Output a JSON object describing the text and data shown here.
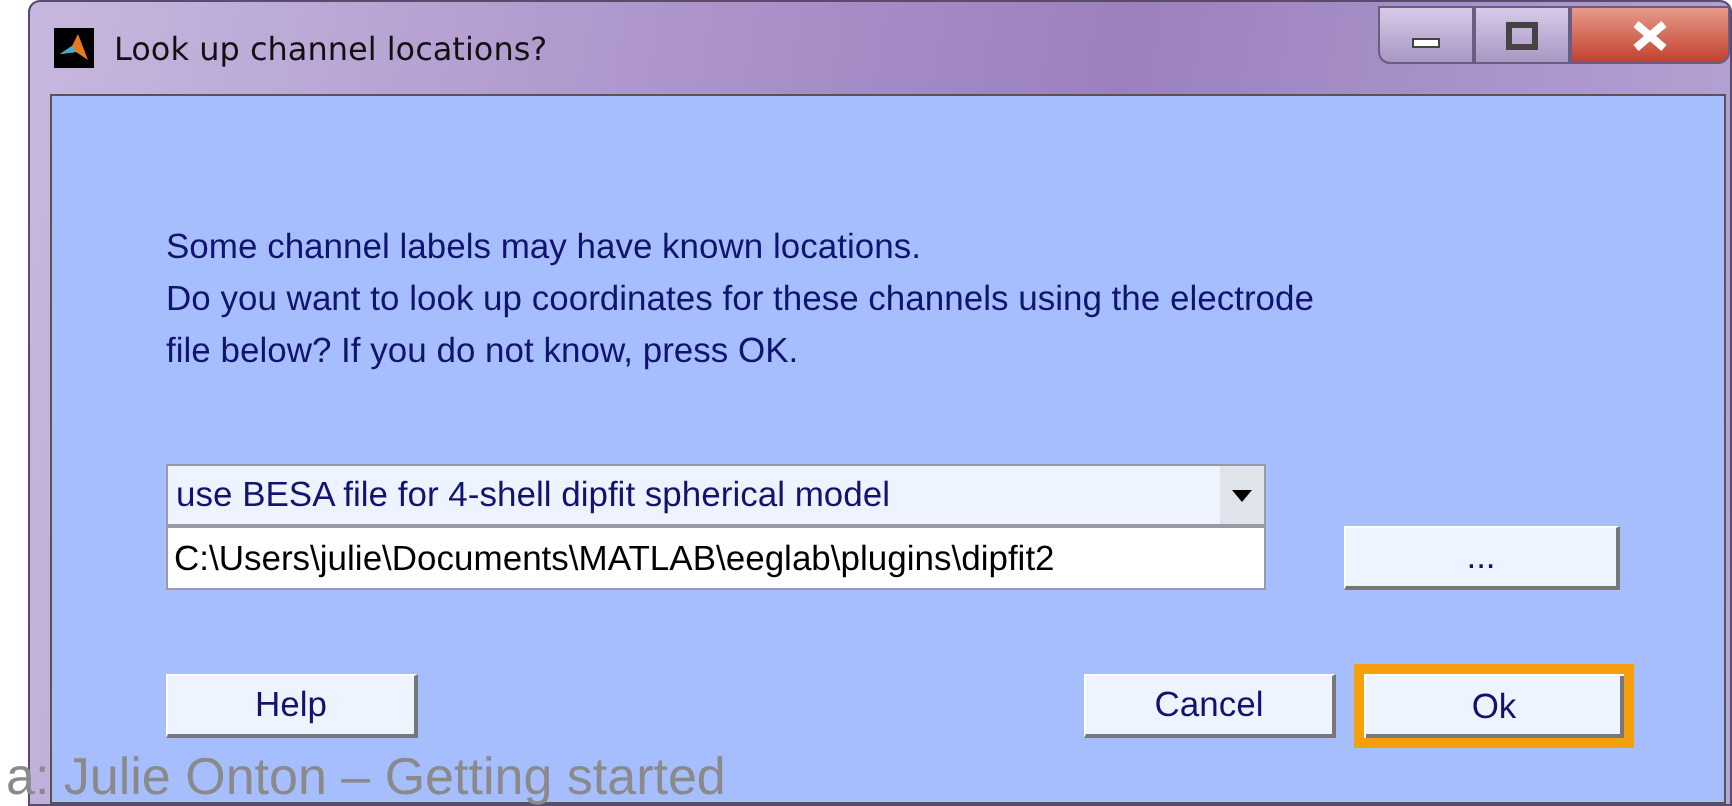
{
  "window": {
    "title": "Look up channel locations?"
  },
  "message": [
    "Some channel labels may have known locations.",
    "Do you want to look up coordinates for these channels using the electrode",
    "file below? If you do not know, press OK."
  ],
  "model_dropdown": {
    "value": "use BESA file for 4-shell dipfit spherical model"
  },
  "file_field": {
    "value": "C:\\Users\\julie\\Documents\\MATLAB\\eeglab\\plugins\\dipfit2"
  },
  "browse_button": {
    "label": "..."
  },
  "buttons": [
    {
      "kind": "help",
      "label": "Help",
      "highlighted": false
    },
    {
      "kind": "cancel",
      "label": "Cancel",
      "highlighted": false
    },
    {
      "kind": "ok",
      "label": "Ok",
      "highlighted": true
    }
  ],
  "slide_footer": "a: Julie Onton – Getting started"
}
